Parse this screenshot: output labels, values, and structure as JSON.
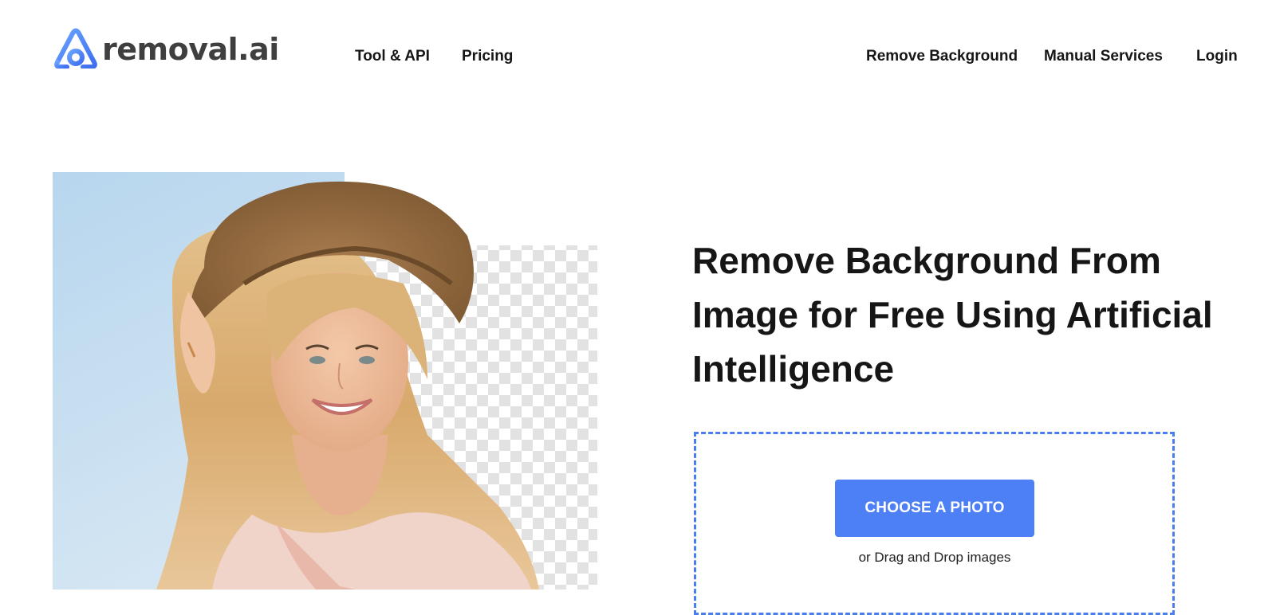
{
  "brand": {
    "name": "removal.ai",
    "accent": "#4d7ff5"
  },
  "nav": {
    "tool_api": "Tool & API",
    "pricing": "Pricing",
    "remove_background": "Remove Background",
    "manual_services": "Manual Services",
    "login": "Login"
  },
  "hero": {
    "title": "Remove Background From Image for Free Using Artificial Intelligence",
    "image_alt": "Smiling woman in a straw hat with half of the background removed"
  },
  "upload": {
    "button_label": "CHOOSE A PHOTO",
    "drop_hint": "or Drag and Drop images",
    "border_color": "#4a7ef0"
  }
}
